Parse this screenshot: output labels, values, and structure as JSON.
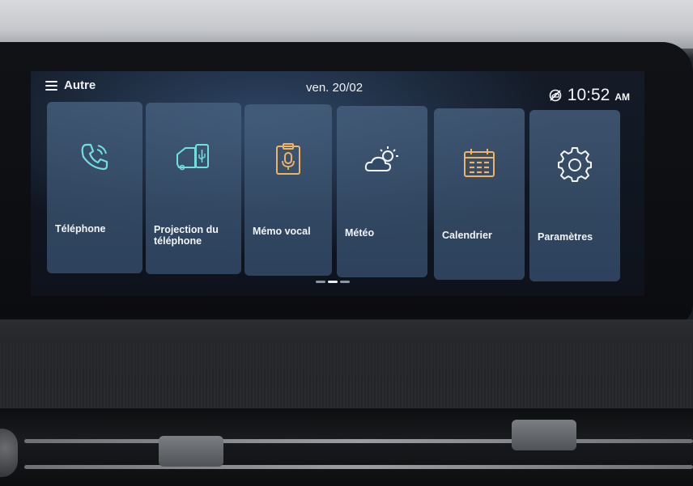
{
  "header": {
    "menu_label": "Autre",
    "date": "ven. 20/02",
    "time": "10:52",
    "ampm": "AM"
  },
  "tiles": [
    {
      "label": "Téléphone",
      "icon": "phone-icon",
      "color": "#6fe0dc"
    },
    {
      "label": "Projection du téléphone",
      "icon": "phone-projection-icon",
      "color": "#6fe0dc"
    },
    {
      "label": "Mémo vocal",
      "icon": "voice-memo-icon",
      "color": "#f0b460"
    },
    {
      "label": "Météo",
      "icon": "weather-icon",
      "color": "#f2f4f7"
    },
    {
      "label": "Calendrier",
      "icon": "calendar-icon",
      "color": "#f0b460"
    },
    {
      "label": "Paramètres",
      "icon": "gear-icon",
      "color": "#f2f4f7"
    }
  ],
  "pager": {
    "pages": 3,
    "active": 2
  }
}
